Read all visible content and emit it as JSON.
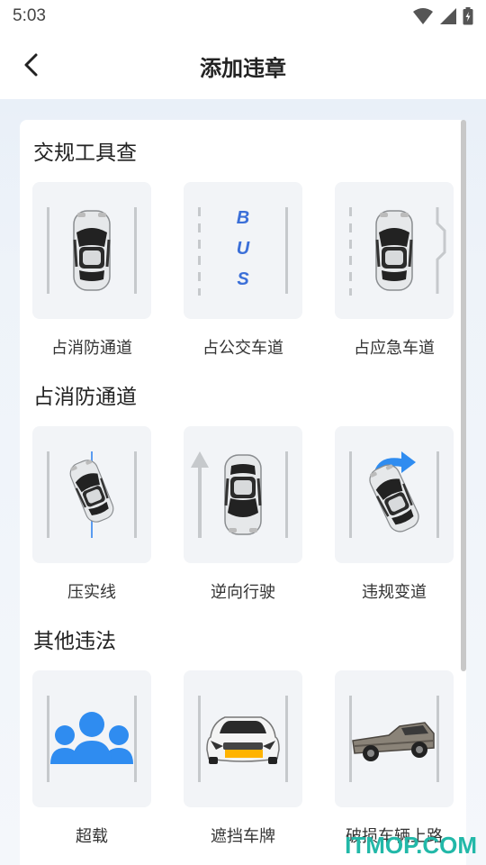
{
  "status_bar": {
    "time": "5:03"
  },
  "header": {
    "title": "添加违章"
  },
  "sections": [
    {
      "title": "交规工具查",
      "items": [
        "占消防通道",
        "占公交车道",
        "占应急车道"
      ]
    },
    {
      "title": "占消防通道",
      "items": [
        "压实线",
        "逆向行驶",
        "违规变道"
      ]
    },
    {
      "title": "其他违法",
      "items": [
        "超载",
        "遮挡车牌",
        "破损车辆上路"
      ]
    }
  ],
  "bus_lettering": [
    "B",
    "U",
    "S"
  ],
  "watermark": "ITMOP.COM",
  "colors": {
    "accent_blue": "#2f8cf0",
    "tile_bg": "#f2f4f7",
    "watermark": "#22b8a8"
  }
}
